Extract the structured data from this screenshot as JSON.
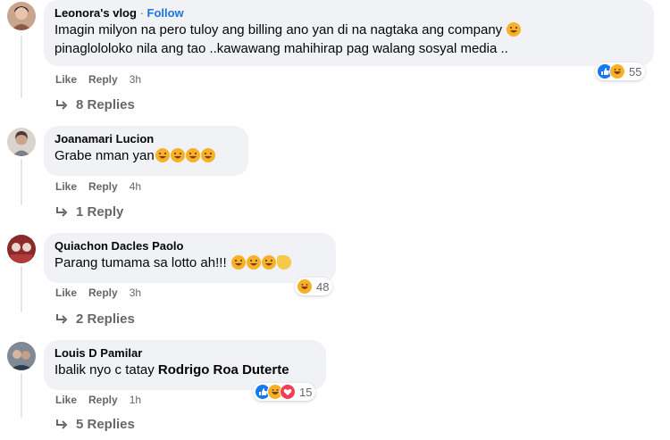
{
  "comments": [
    {
      "author": "Leonora's vlog",
      "follow_sep": " · ",
      "follow_label": "Follow",
      "text_line1": "Imagin milyon na pero tuloy ang billing ano yan di na nagtaka ang company",
      "text_line2": "pinaglololoko nila ang tao ..kawawang mahihirap pag walang sosyal media ..",
      "inline_emojis": [
        "rolling-laugh-emoji"
      ],
      "like": "Like",
      "reply": "Reply",
      "time": "3h",
      "replies": "8 Replies",
      "reaction_count": "55",
      "reactions": [
        "like",
        "haha"
      ]
    },
    {
      "author": "Joanamari Lucion",
      "text": "Grabe nman yan",
      "inline_emojis": [
        "grin-emoji",
        "grin-emoji",
        "grin-emoji",
        "grin-emoji"
      ],
      "like": "Like",
      "reply": "Reply",
      "time": "4h",
      "replies": "1 Reply"
    },
    {
      "author": "Quiachon Dacles Paolo",
      "text": "Parang tumama sa lotto ah!!!",
      "inline_emojis": [
        "rolling-laugh-emoji",
        "rolling-laugh-emoji",
        "rolling-laugh-emoji",
        "clap-emoji"
      ],
      "like": "Like",
      "reply": "Reply",
      "time": "3h",
      "replies": "2 Replies",
      "reaction_count": "48",
      "reactions": [
        "haha"
      ]
    },
    {
      "author": "Louis D Pamilar",
      "text_plain": "Ibalik nyo c tatay ",
      "text_bold": "Rodrigo Roa Duterte",
      "like": "Like",
      "reply": "Reply",
      "time": "1h",
      "replies": "5 Replies",
      "reaction_count": "15",
      "reactions": [
        "like",
        "haha",
        "love"
      ]
    }
  ],
  "colors": {
    "bubble": "#f0f2f5",
    "meta": "#65676b",
    "follow": "#1b74e4",
    "like_blue": "#1877f2",
    "haha_yellow": "#f7b125",
    "love_red": "#f33e58"
  }
}
